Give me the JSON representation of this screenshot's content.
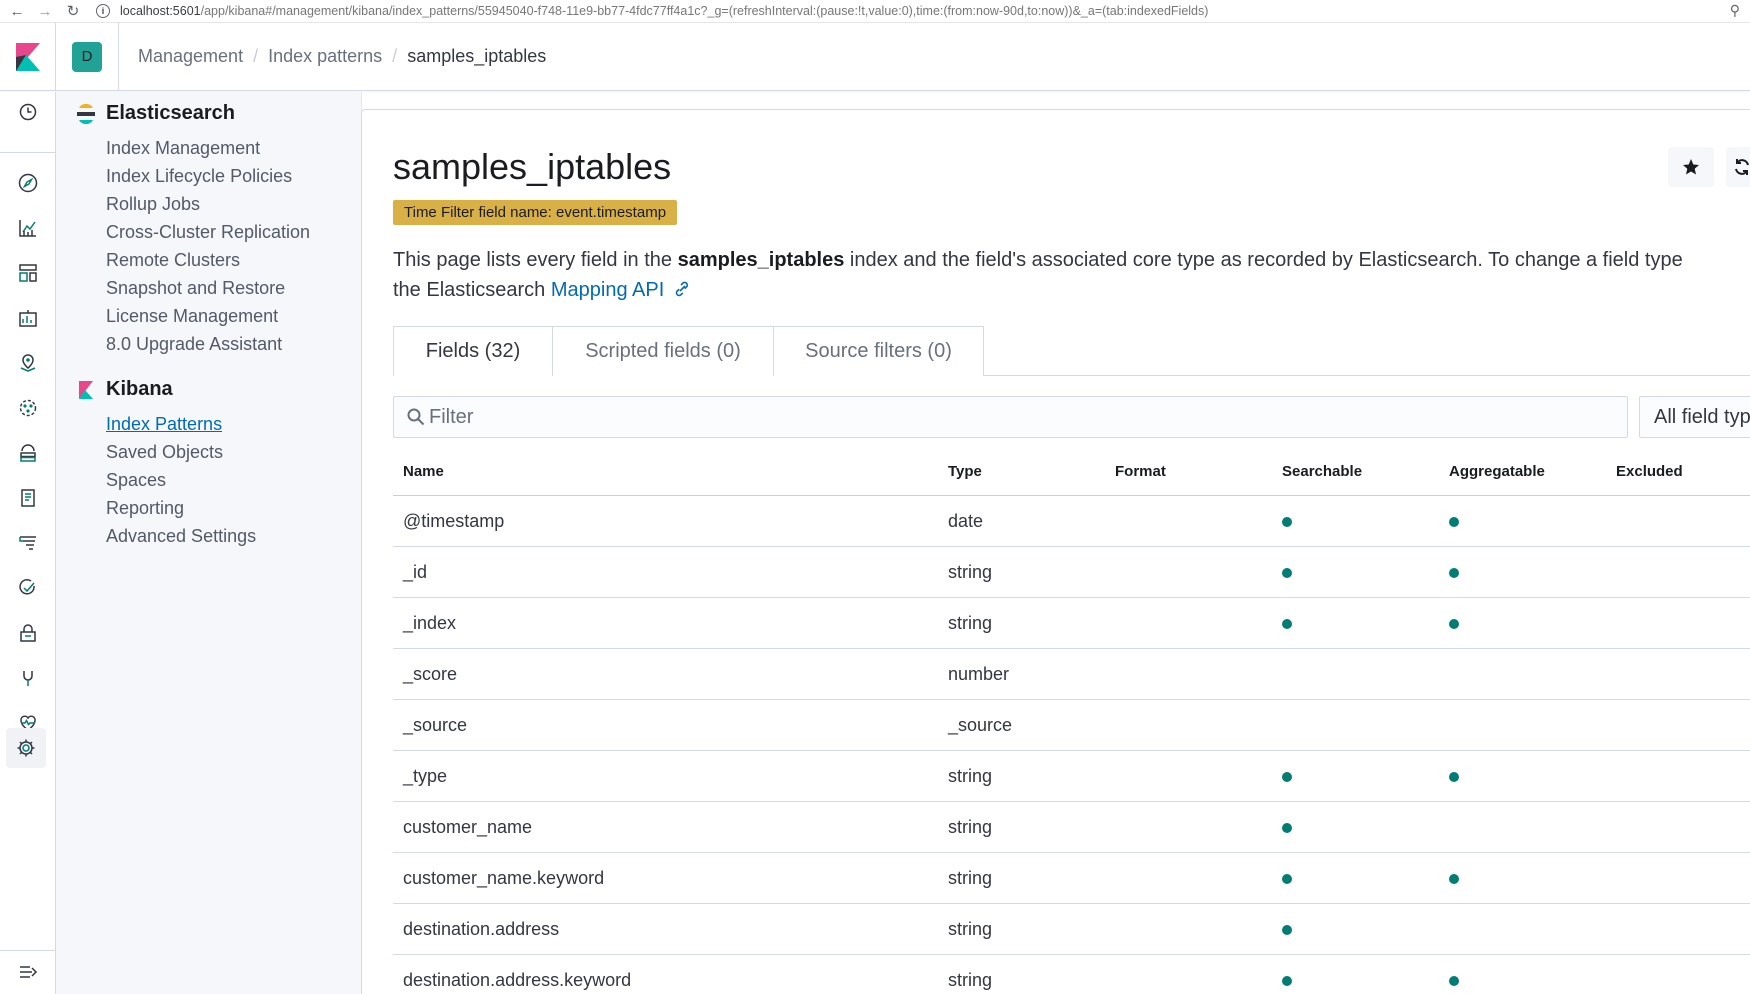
{
  "browser": {
    "url_host": "localhost:5601",
    "url_path": "/app/kibana#/management/kibana/index_patterns/55945040-f748-11e9-bb77-4fdc77ff4a1c?_g=(refreshInterval:(pause:!t,value:0),time:(from:now-90d,to:now))&_a=(tab:indexedFields)"
  },
  "header": {
    "space_initial": "D",
    "breadcrumbs": [
      "Management",
      "Index patterns",
      "samples_iptables"
    ]
  },
  "sidebar": {
    "groups": [
      {
        "title": "Elasticsearch",
        "items": [
          "Index Management",
          "Index Lifecycle Policies",
          "Rollup Jobs",
          "Cross-Cluster Replication",
          "Remote Clusters",
          "Snapshot and Restore",
          "License Management",
          "8.0 Upgrade Assistant"
        ]
      },
      {
        "title": "Kibana",
        "items": [
          "Index Patterns",
          "Saved Objects",
          "Spaces",
          "Reporting",
          "Advanced Settings"
        ]
      }
    ],
    "selected": "Index Patterns"
  },
  "main": {
    "title": "samples_iptables",
    "time_filter_badge": "Time Filter field name: event.timestamp",
    "description": {
      "part1": "This page lists every field in the ",
      "index_name": "samples_iptables",
      "part2": " index and the field's associated core type as recorded by Elasticsearch. To change a field type",
      "part3": "the Elasticsearch ",
      "link": "Mapping API"
    },
    "tabs": [
      "Fields (32)",
      "Scripted fields (0)",
      "Source filters (0)"
    ],
    "filter_placeholder": "Filter",
    "field_type_select": "All field types"
  },
  "table": {
    "columns": [
      "Name",
      "Type",
      "Format",
      "Searchable",
      "Aggregatable",
      "Excluded"
    ],
    "rows": [
      {
        "name": "@timestamp",
        "type": "date",
        "searchable": true,
        "aggregatable": true
      },
      {
        "name": "_id",
        "type": "string",
        "searchable": true,
        "aggregatable": true
      },
      {
        "name": "_index",
        "type": "string",
        "searchable": true,
        "aggregatable": true
      },
      {
        "name": "_score",
        "type": "number",
        "searchable": false,
        "aggregatable": false
      },
      {
        "name": "_source",
        "type": "_source",
        "searchable": false,
        "aggregatable": false
      },
      {
        "name": "_type",
        "type": "string",
        "searchable": true,
        "aggregatable": true
      },
      {
        "name": "customer_name",
        "type": "string",
        "searchable": true,
        "aggregatable": false
      },
      {
        "name": "customer_name.keyword",
        "type": "string",
        "searchable": true,
        "aggregatable": true
      },
      {
        "name": "destination.address",
        "type": "string",
        "searchable": true,
        "aggregatable": false
      },
      {
        "name": "destination.address.keyword",
        "type": "string",
        "searchable": true,
        "aggregatable": true
      }
    ]
  },
  "colors": {
    "accent": "#006bb4",
    "badge": "#d8b046",
    "dot": "#017d73",
    "space_avatar": "#20a396"
  }
}
